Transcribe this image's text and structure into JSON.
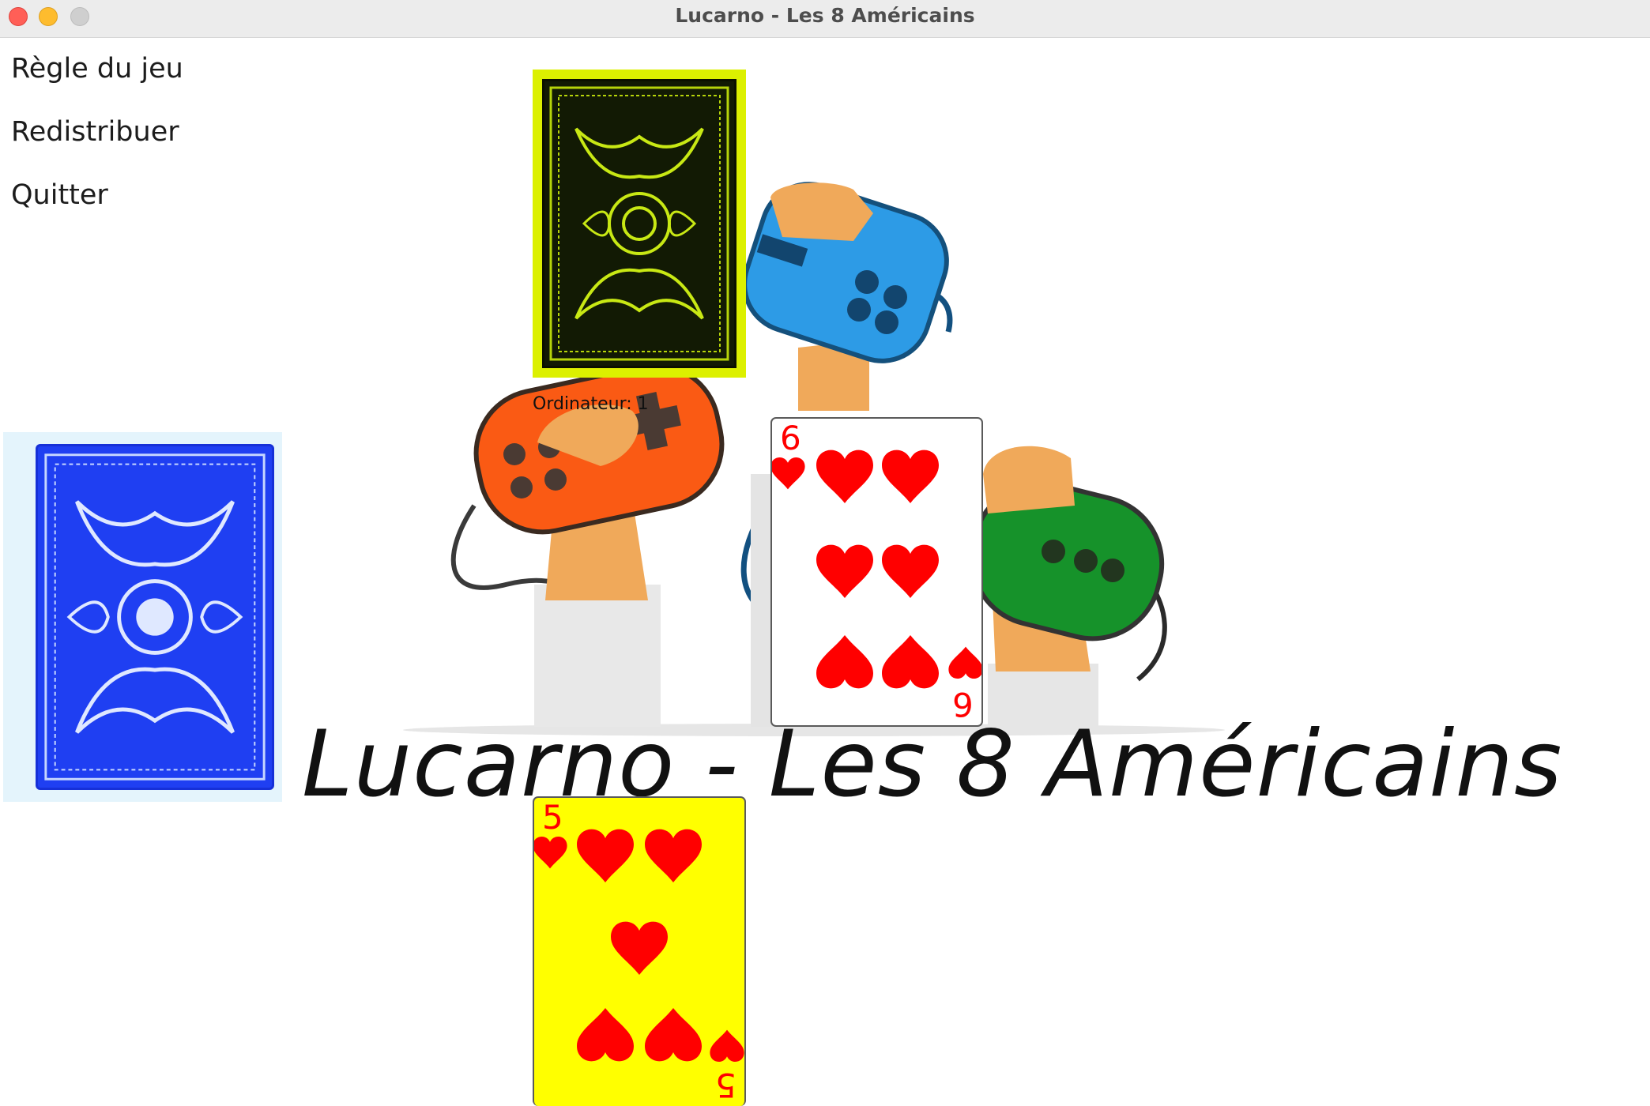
{
  "window": {
    "title": "Lucarno - Les 8 Américains"
  },
  "menu": {
    "rules": "Règle du jeu",
    "redeal": "Redistribuer",
    "quit": "Quitter"
  },
  "logo": {
    "text": "Lucarno - Les 8 Américains"
  },
  "computer": {
    "label": "Ordinateur: 1",
    "card_back_color": "#dcf000"
  },
  "draw_pile": {
    "card_back_color": "#1f3ff2"
  },
  "pile_card": {
    "rank": "6",
    "suit": "hearts",
    "face_color": "#ffffff"
  },
  "hand_card": {
    "rank": "5",
    "suit": "hearts",
    "face_color": "#ffff00"
  },
  "colors": {
    "heart": "#ff0000",
    "controller_orange": "#fa5a14",
    "controller_blue": "#2d9be6",
    "controller_green": "#16922a"
  }
}
